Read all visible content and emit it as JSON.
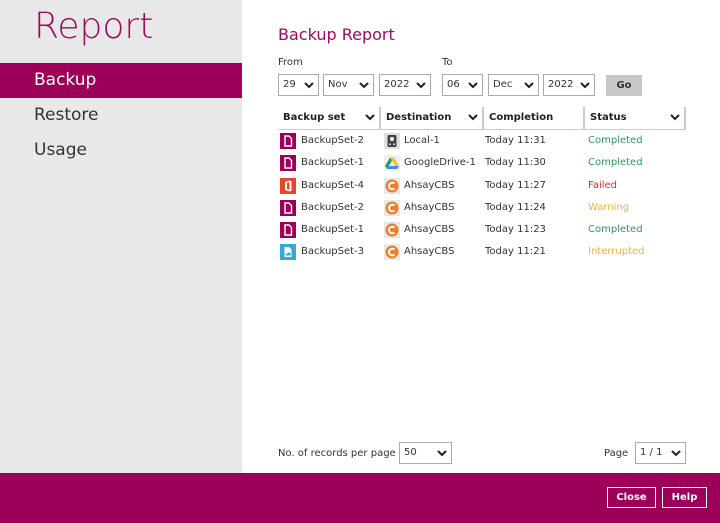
{
  "app": {
    "title": "Report"
  },
  "sidebar": {
    "items": [
      {
        "label": "Backup",
        "active": true
      },
      {
        "label": "Restore",
        "active": false
      },
      {
        "label": "Usage",
        "active": false
      }
    ]
  },
  "main": {
    "title": "Backup Report",
    "from": {
      "label": "From",
      "day": "29",
      "month": "Nov",
      "year": "2022"
    },
    "to": {
      "label": "To",
      "day": "06",
      "month": "Dec",
      "year": "2022"
    },
    "go_label": "Go",
    "table": {
      "columns": [
        "Backup set",
        "Destination",
        "Completion",
        "Status"
      ],
      "rows": [
        {
          "backup_set": "BackupSet-2",
          "set_icon": "file-icon",
          "destination": "Local-1",
          "dest_icon": "local-drive-icon",
          "completion": "Today 11:31",
          "status": "Completed"
        },
        {
          "backup_set": "BackupSet-1",
          "set_icon": "file-icon",
          "destination": "GoogleDrive-1",
          "dest_icon": "google-drive-icon",
          "completion": "Today 11:30",
          "status": "Completed"
        },
        {
          "backup_set": "BackupSet-4",
          "set_icon": "office365-icon",
          "destination": "AhsayCBS",
          "dest_icon": "ahsaycbs-icon",
          "completion": "Today 11:27",
          "status": "Failed"
        },
        {
          "backup_set": "BackupSet-2",
          "set_icon": "file-icon",
          "destination": "AhsayCBS",
          "dest_icon": "ahsaycbs-icon",
          "completion": "Today 11:24",
          "status": "Warning"
        },
        {
          "backup_set": "BackupSet-1",
          "set_icon": "file-icon",
          "destination": "AhsayCBS",
          "dest_icon": "ahsaycbs-icon",
          "completion": "Today 11:23",
          "status": "Completed"
        },
        {
          "backup_set": "BackupSet-3",
          "set_icon": "cloud-file-icon",
          "destination": "AhsayCBS",
          "dest_icon": "ahsaycbs-icon",
          "completion": "Today 11:21",
          "status": "Interrupted"
        }
      ]
    },
    "records_label": "No. of records per page",
    "records_value": "50",
    "page_label": "Page",
    "page_value": "1 / 1"
  },
  "footer": {
    "close_label": "Close",
    "help_label": "Help"
  },
  "colors": {
    "brand": "#9c0059",
    "completed": "#2e9a5a",
    "failed": "#e02a2a",
    "warning": "#f0b23c",
    "interrupted": "#f0b23c"
  }
}
